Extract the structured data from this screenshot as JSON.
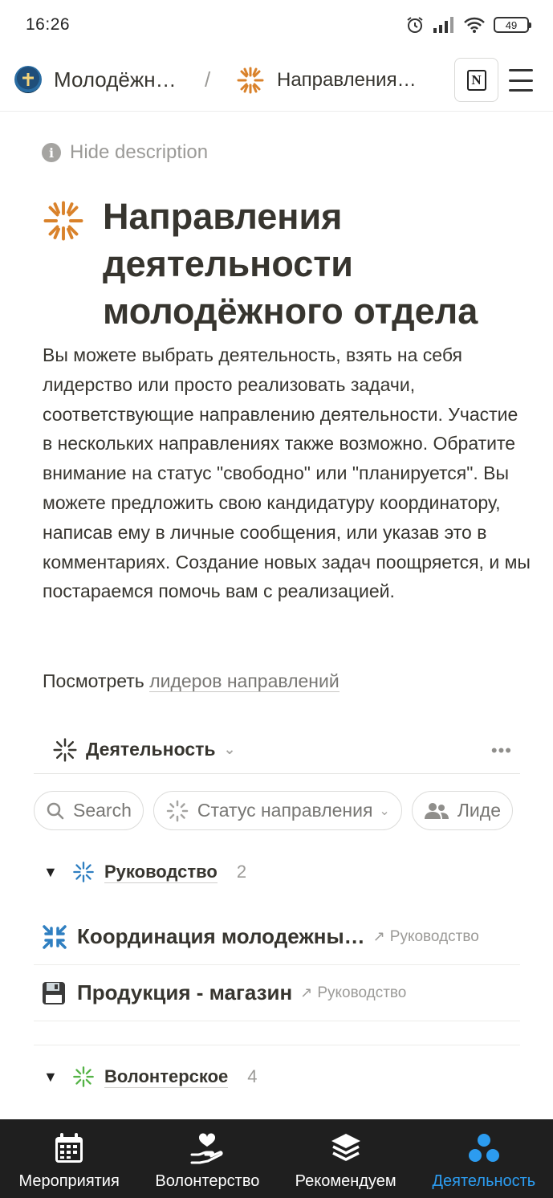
{
  "status_bar": {
    "time": "16:26",
    "battery": "49"
  },
  "breadcrumb": {
    "workspace": "Молодёжн…",
    "separator": "/",
    "page": "Направления…"
  },
  "hide_description": "Hide description",
  "page": {
    "title": "Направления деятельности молодёжного отдела",
    "description": "Вы можете выбрать деятельность, взять на себя лидерство или просто реализовать задачи, соответствующие направлению деятельности. Участие в нескольких направлениях также возможно. Обратите внимание на статус \"свободно\" или \"планируется\". Вы можете предложить свою кандидатуру координатору, написав ему в личные сообщения, или указав это в комментариях. Создание новых задач поощряется, и мы постараемся помочь вам с реализацией.",
    "see_more_prefix": "Посмотреть ",
    "see_more_link": "лидеров направлений"
  },
  "view": {
    "title": "Деятельность",
    "more": "•••"
  },
  "filters": {
    "search": "Search",
    "status": "Статус направления",
    "leaders": "Лиде"
  },
  "groups": [
    {
      "label": "Руководство",
      "count": "2",
      "rows": [
        {
          "title": "Координация молодежны…",
          "relation": "Руководство"
        },
        {
          "title": "Продукция - магазин",
          "relation": "Руководство"
        }
      ]
    },
    {
      "label": "Волонтерское",
      "count": "4"
    }
  ],
  "tabs": [
    {
      "label": "Мероприятия",
      "icon": "calendar-icon"
    },
    {
      "label": "Волонтерство",
      "icon": "heart-hand-icon"
    },
    {
      "label": "Рекомендуем",
      "icon": "layers-icon"
    },
    {
      "label": "Деятельность",
      "icon": "dots-icon",
      "active": true
    }
  ],
  "colors": {
    "accent": "#2c9cf0",
    "orange": "#d9822b",
    "blue_icon": "#2f7fc1",
    "green_icon": "#55b347"
  }
}
